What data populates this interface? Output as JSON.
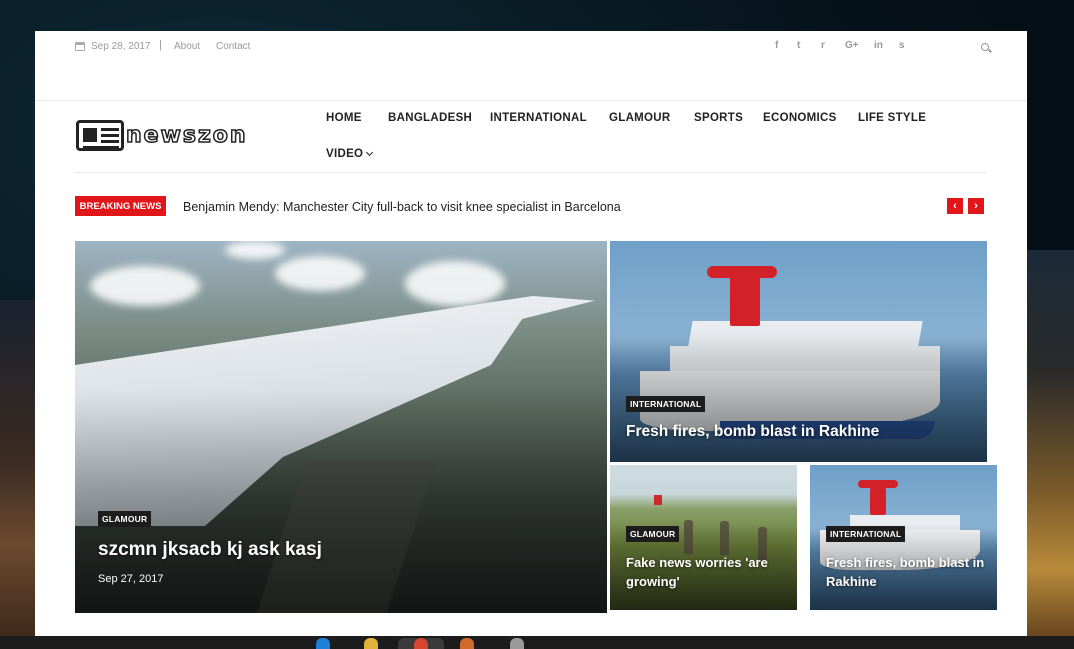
{
  "topbar": {
    "date": "Sep 28, 2017",
    "links": [
      "About",
      "Contact"
    ],
    "social_icons": [
      "facebook-icon",
      "twitter-icon",
      "rss-icon",
      "google-plus-icon",
      "linkedin-icon",
      "skype-icon"
    ],
    "social_glyphs": [
      "f",
      "t",
      "r",
      "G+",
      "in",
      "s"
    ]
  },
  "logo": {
    "text": "newszon"
  },
  "nav": {
    "items": [
      "HOME",
      "BANGLADESH",
      "INTERNATIONAL",
      "GLAMOUR",
      "SPORTS",
      "ECONOMICS",
      "LIFE STYLE"
    ],
    "video": "VIDEO"
  },
  "breaking": {
    "label": "BREAKING NEWS",
    "headline": "Benjamin Mendy: Manchester City full-back to visit knee specialist in Barcelona",
    "prev": "‹",
    "next": "›"
  },
  "featured": [
    {
      "category": "GLAMOUR",
      "title": "szcmn jksacb kj ask kasj",
      "date": "Sep 27, 2017"
    },
    {
      "category": "INTERNATIONAL",
      "title": "Fresh fires, bomb blast in Rakhine"
    },
    {
      "category": "GLAMOUR",
      "title": "Fake news worries 'are growing'"
    },
    {
      "category": "INTERNATIONAL",
      "title": "Fresh fires, bomb blast in Rakhine"
    }
  ],
  "colors": {
    "accent": "#e0161b",
    "badge": "#1d1d1d"
  }
}
